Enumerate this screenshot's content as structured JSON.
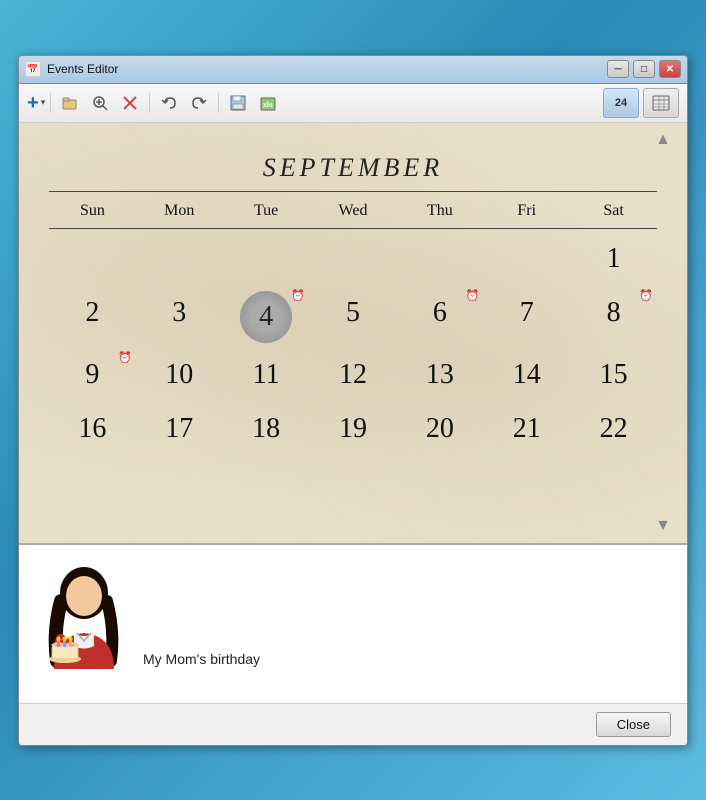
{
  "window": {
    "title": "Events Editor",
    "title_icon": "📅"
  },
  "title_controls": {
    "minimize": "─",
    "maximize": "□",
    "close": "✕"
  },
  "toolbar": {
    "add_label": "+",
    "add_arrow": "▾",
    "open_label": "📂",
    "zoom_label": "🔍",
    "delete_label": "✕",
    "undo_label": "↩",
    "redo_label": "↪",
    "save_label": "💾",
    "calendar2_label": "📆",
    "view_day_label": "24",
    "view_month_label": "▦"
  },
  "calendar": {
    "month": "SEPTEMBER",
    "weekdays": [
      "Sun",
      "Mon",
      "Tue",
      "Wed",
      "Thu",
      "Fri",
      "Sat"
    ],
    "selected_day": 4,
    "days": [
      {
        "day": "",
        "col": 1
      },
      {
        "day": "",
        "col": 2
      },
      {
        "day": "",
        "col": 3
      },
      {
        "day": "",
        "col": 4
      },
      {
        "day": "",
        "col": 5
      },
      {
        "day": "",
        "col": 6
      },
      {
        "day": "1",
        "alarm": false
      },
      {
        "day": "2",
        "alarm": false
      },
      {
        "day": "3",
        "alarm": false
      },
      {
        "day": "4",
        "alarm": true,
        "selected": true
      },
      {
        "day": "5",
        "alarm": false
      },
      {
        "day": "6",
        "alarm": true
      },
      {
        "day": "7",
        "alarm": false
      },
      {
        "day": "8",
        "alarm": true
      },
      {
        "day": "9",
        "alarm": true
      },
      {
        "day": "10",
        "alarm": false
      },
      {
        "day": "11",
        "alarm": false
      },
      {
        "day": "12",
        "alarm": false
      },
      {
        "day": "13",
        "alarm": false
      },
      {
        "day": "14",
        "alarm": false
      },
      {
        "day": "15",
        "alarm": false
      },
      {
        "day": "16",
        "alarm": false
      },
      {
        "day": "17",
        "alarm": false
      },
      {
        "day": "18",
        "alarm": false
      },
      {
        "day": "19",
        "alarm": false
      },
      {
        "day": "20",
        "alarm": false
      },
      {
        "day": "21",
        "alarm": false
      },
      {
        "day": "22",
        "alarm": false
      }
    ]
  },
  "event": {
    "label": "My Mom's birthday",
    "avatar_description": "woman with birthday cake"
  },
  "footer": {
    "close_label": "Close"
  }
}
